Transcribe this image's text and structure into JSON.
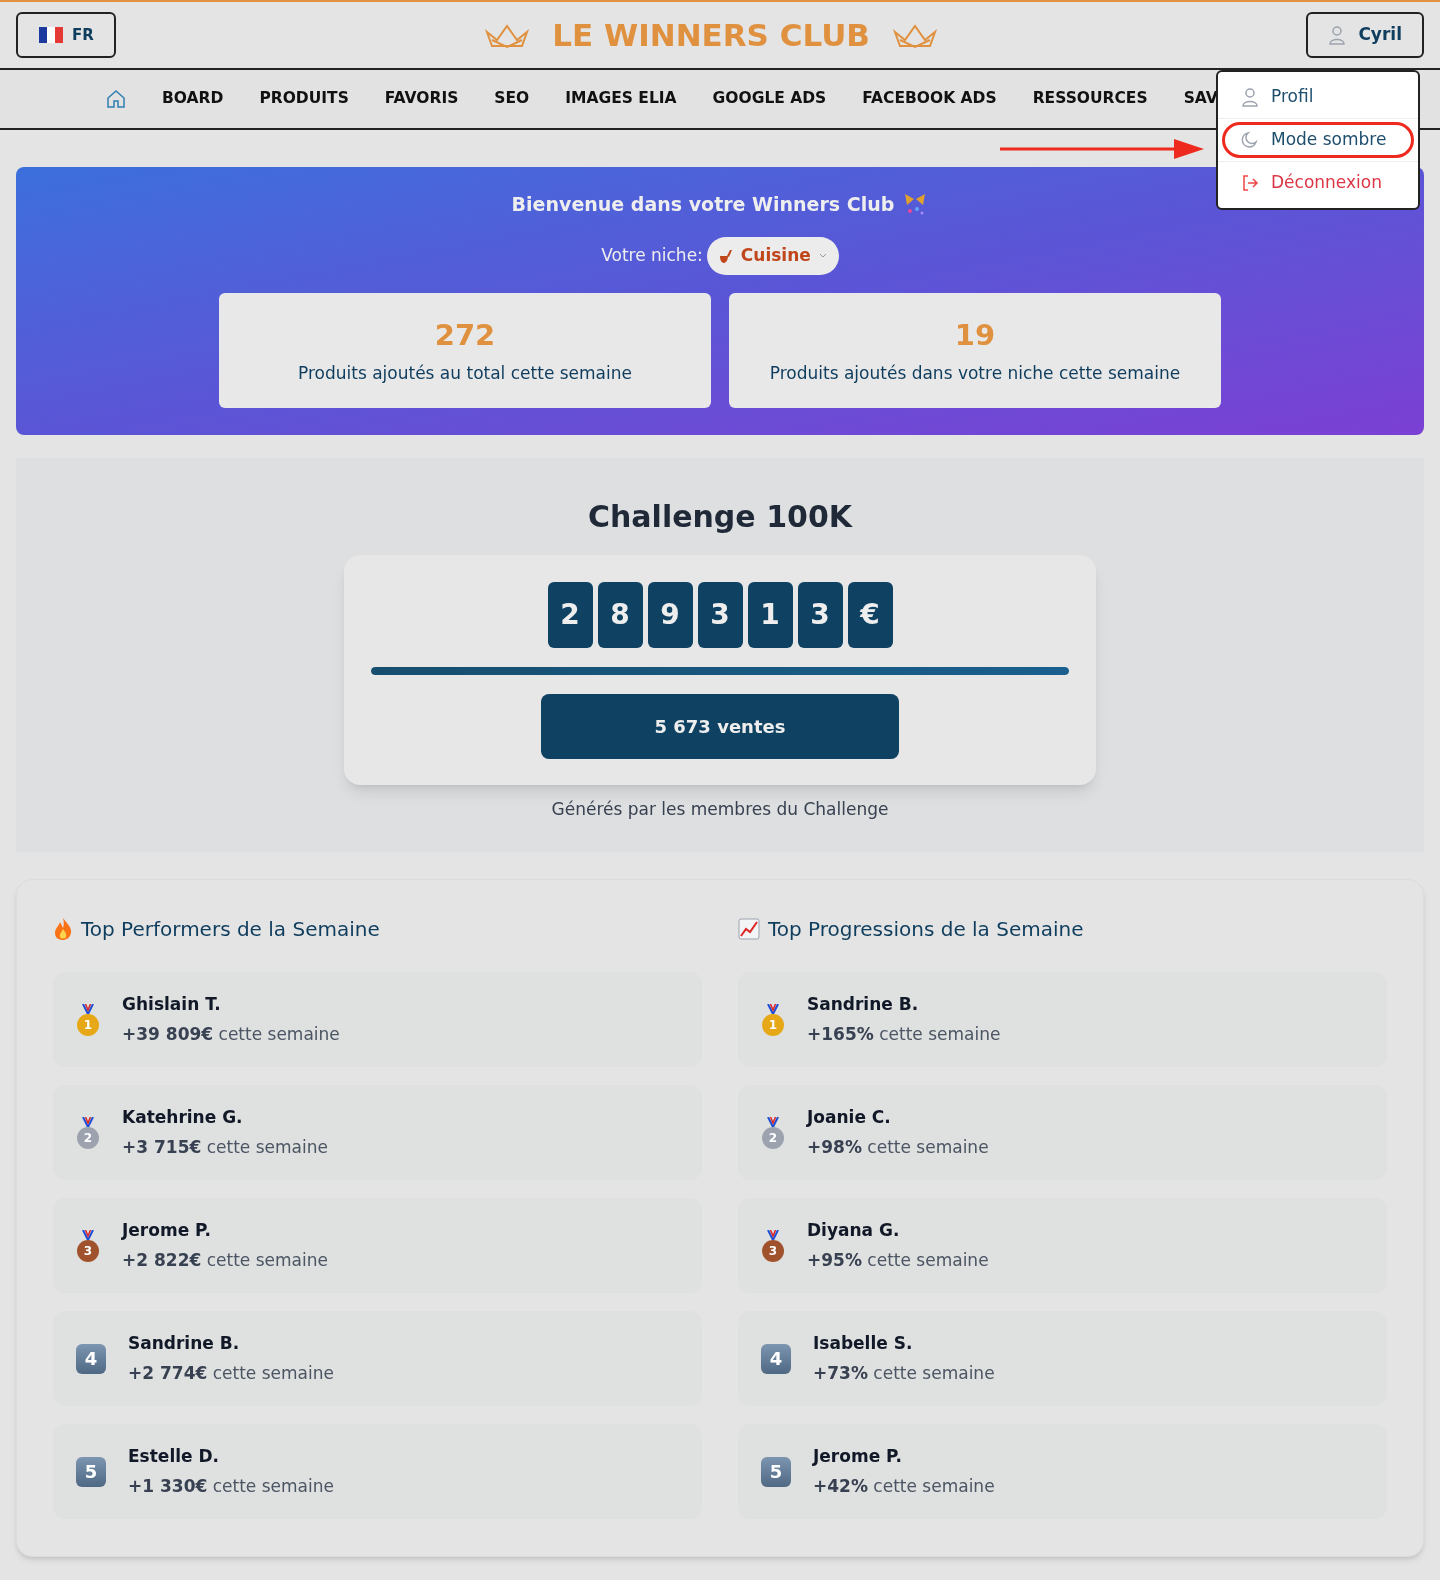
{
  "header": {
    "language": "FR",
    "logo": "LE WINNERS CLUB",
    "user": "Cyril"
  },
  "nav": [
    {
      "label": "BOARD"
    },
    {
      "label": "PRODUITS"
    },
    {
      "label": "FAVORIS"
    },
    {
      "label": "SEO"
    },
    {
      "label": "IMAGES ELIA"
    },
    {
      "label": "GOOGLE ADS"
    },
    {
      "label": "FACEBOOK ADS"
    },
    {
      "label": "RESSOURCES"
    },
    {
      "label": "SAV"
    }
  ],
  "user_menu": [
    {
      "kind": "profile",
      "label": "Profil",
      "highlighted": false
    },
    {
      "kind": "dark",
      "label": "Mode sombre",
      "highlighted": true
    },
    {
      "kind": "logout",
      "label": "Déconnexion",
      "highlighted": false
    }
  ],
  "welcome": {
    "title": "Bienvenue dans votre Winners Club",
    "niche_label": "Votre niche:",
    "niche": "Cuisine",
    "stats": [
      {
        "value": "272",
        "label": "Produits ajoutés au total cette semaine"
      },
      {
        "value": "19",
        "label": "Produits ajoutés dans votre niche cette semaine"
      }
    ]
  },
  "challenge": {
    "title": "Challenge 100K",
    "digits": [
      "2",
      "8",
      "9",
      "3",
      "1",
      "3",
      "€"
    ],
    "level": 1,
    "sales": "5 673 ventes",
    "caption": "Générés par les membres du Challenge"
  },
  "leaderboards": [
    {
      "kind": "fire",
      "title": "Top Performers de la Semaine",
      "rows": [
        {
          "rank": "1",
          "kind": "medal",
          "color": "#e6a817",
          "name": "Ghislain T.",
          "value": "+39 809€",
          "suffix": "cette semaine"
        },
        {
          "rank": "2",
          "kind": "medal",
          "color": "#9ca3af",
          "name": "Katehrine G.",
          "value": "+3 715€",
          "suffix": "cette semaine"
        },
        {
          "rank": "3",
          "kind": "medal",
          "color": "#a0522d",
          "name": "Jerome P.",
          "value": "+2 822€",
          "suffix": "cette semaine"
        },
        {
          "rank": "4",
          "kind": "keycap",
          "name": "Sandrine B.",
          "value": "+2 774€",
          "suffix": "cette semaine"
        },
        {
          "rank": "5",
          "kind": "keycap",
          "name": "Estelle D.",
          "value": "+1 330€",
          "suffix": "cette semaine"
        }
      ]
    },
    {
      "kind": "chart",
      "title": "Top Progressions de la Semaine",
      "rows": [
        {
          "rank": "1",
          "kind": "medal",
          "color": "#e6a817",
          "name": "Sandrine B.",
          "value": "+165%",
          "suffix": "cette semaine"
        },
        {
          "rank": "2",
          "kind": "medal",
          "color": "#9ca3af",
          "name": "Joanie C.",
          "value": "+98%",
          "suffix": "cette semaine"
        },
        {
          "rank": "3",
          "kind": "medal",
          "color": "#a0522d",
          "name": "Diyana G.",
          "value": "+95%",
          "suffix": "cette semaine"
        },
        {
          "rank": "4",
          "kind": "keycap",
          "name": "Isabelle S.",
          "value": "+73%",
          "suffix": "cette semaine"
        },
        {
          "rank": "5",
          "kind": "keycap",
          "name": "Jerome P.",
          "value": "+42%",
          "suffix": "cette semaine"
        }
      ]
    }
  ]
}
